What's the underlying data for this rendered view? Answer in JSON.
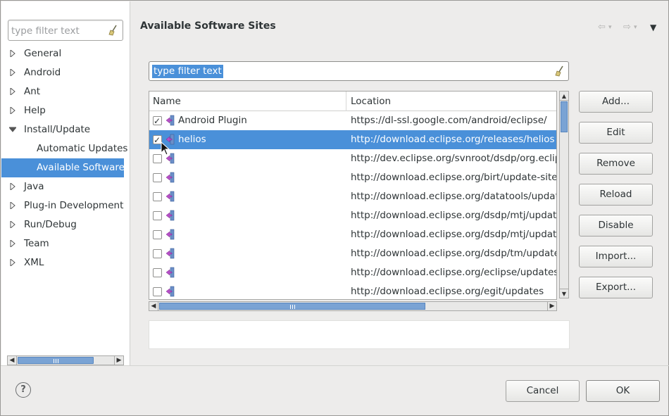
{
  "left_panel": {
    "filter_placeholder": "type filter text",
    "tree": [
      {
        "label": "General",
        "expanded": false
      },
      {
        "label": "Android",
        "expanded": false
      },
      {
        "label": "Ant",
        "expanded": false
      },
      {
        "label": "Help",
        "expanded": false
      },
      {
        "label": "Install/Update",
        "expanded": true
      },
      {
        "label": "Automatic Updates",
        "child": true
      },
      {
        "label": "Available Software",
        "child": true,
        "selected": true
      },
      {
        "label": "Java",
        "expanded": false
      },
      {
        "label": "Plug-in Development",
        "expanded": false
      },
      {
        "label": "Run/Debug",
        "expanded": false
      },
      {
        "label": "Team",
        "expanded": false
      },
      {
        "label": "XML",
        "expanded": false
      }
    ]
  },
  "page": {
    "title": "Available Software Sites",
    "back_icon": "back-arrow-icon",
    "forward_icon": "forward-arrow-icon",
    "menu_icon": "view-menu-icon"
  },
  "sites_filter": {
    "value": "type filter text"
  },
  "table": {
    "columns": [
      "Name",
      "Location"
    ],
    "rows": [
      {
        "checked": true,
        "name": "Android Plugin",
        "location": "https://dl-ssl.google.com/android/eclipse/",
        "selected": false
      },
      {
        "checked": true,
        "name": "helios",
        "location": "http://download.eclipse.org/releases/helios",
        "selected": true
      },
      {
        "checked": false,
        "name": "",
        "location": "http://dev.eclipse.org/svnroot/dsdp/org.eclipse",
        "selected": false
      },
      {
        "checked": false,
        "name": "",
        "location": "http://download.eclipse.org/birt/update-site/",
        "selected": false
      },
      {
        "checked": false,
        "name": "",
        "location": "http://download.eclipse.org/datatools/updates",
        "selected": false
      },
      {
        "checked": false,
        "name": "",
        "location": "http://download.eclipse.org/dsdp/mtj/updates",
        "selected": false
      },
      {
        "checked": false,
        "name": "",
        "location": "http://download.eclipse.org/dsdp/mtj/updates",
        "selected": false
      },
      {
        "checked": false,
        "name": "",
        "location": "http://download.eclipse.org/dsdp/tm/updates",
        "selected": false
      },
      {
        "checked": false,
        "name": "",
        "location": "http://download.eclipse.org/eclipse/updates/",
        "selected": false
      },
      {
        "checked": false,
        "name": "",
        "location": "http://download.eclipse.org/egit/updates",
        "selected": false
      }
    ]
  },
  "side_buttons": {
    "add": "Add...",
    "edit": "Edit",
    "remove": "Remove",
    "reload": "Reload",
    "disable": "Disable",
    "import": "Import...",
    "export": "Export..."
  },
  "footer": {
    "help": "?",
    "cancel": "Cancel",
    "ok": "OK"
  },
  "colors": {
    "selection": "#4a90d9",
    "background": "#edeceb"
  }
}
